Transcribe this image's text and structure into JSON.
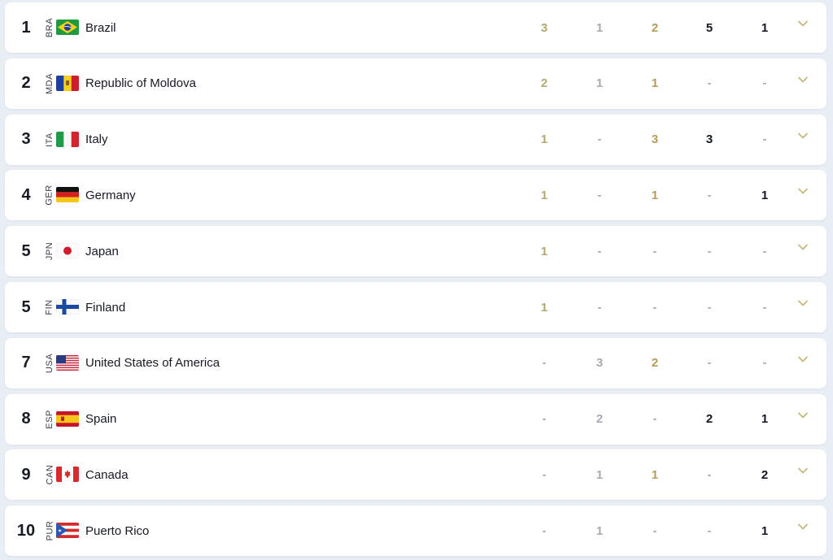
{
  "rows": [
    {
      "rank": "1",
      "code": "BRA",
      "country": "Brazil",
      "flag": "brazil-flag-icon",
      "gold": "3",
      "silver": "1",
      "bronze": "2",
      "col4": "5",
      "col5": "1"
    },
    {
      "rank": "2",
      "code": "MDA",
      "country": "Republic of Moldova",
      "flag": "moldova-flag-icon",
      "gold": "2",
      "silver": "1",
      "bronze": "1",
      "col4": "-",
      "col5": "-"
    },
    {
      "rank": "3",
      "code": "ITA",
      "country": "Italy",
      "flag": "italy-flag-icon",
      "gold": "1",
      "silver": "-",
      "bronze": "3",
      "col4": "3",
      "col5": "-"
    },
    {
      "rank": "4",
      "code": "GER",
      "country": "Germany",
      "flag": "germany-flag-icon",
      "gold": "1",
      "silver": "-",
      "bronze": "1",
      "col4": "-",
      "col5": "1"
    },
    {
      "rank": "5",
      "code": "JPN",
      "country": "Japan",
      "flag": "japan-flag-icon",
      "gold": "1",
      "silver": "-",
      "bronze": "-",
      "col4": "-",
      "col5": "-"
    },
    {
      "rank": "5",
      "code": "FIN",
      "country": "Finland",
      "flag": "finland-flag-icon",
      "gold": "1",
      "silver": "-",
      "bronze": "-",
      "col4": "-",
      "col5": "-"
    },
    {
      "rank": "7",
      "code": "USA",
      "country": "United States of America",
      "flag": "usa-flag-icon",
      "gold": "-",
      "silver": "3",
      "bronze": "2",
      "col4": "-",
      "col5": "-"
    },
    {
      "rank": "8",
      "code": "ESP",
      "country": "Spain",
      "flag": "spain-flag-icon",
      "gold": "-",
      "silver": "2",
      "bronze": "-",
      "col4": "2",
      "col5": "1"
    },
    {
      "rank": "9",
      "code": "CAN",
      "country": "Canada",
      "flag": "canada-flag-icon",
      "gold": "-",
      "silver": "1",
      "bronze": "1",
      "col4": "-",
      "col5": "2"
    },
    {
      "rank": "10",
      "code": "PUR",
      "country": "Puerto Rico",
      "flag": "puerto-rico-flag-icon",
      "gold": "-",
      "silver": "1",
      "bronze": "-",
      "col4": "-",
      "col5": "1"
    }
  ],
  "colors": {
    "gold": "#b3a86e",
    "silver": "#a7abb2",
    "bronze": "#b59b5c",
    "text": "#141820",
    "accent_chevron": "#c2b87c",
    "background": "#e9edf4",
    "row": "#ffffff"
  },
  "icons": {
    "expand": "chevron-down-icon"
  }
}
